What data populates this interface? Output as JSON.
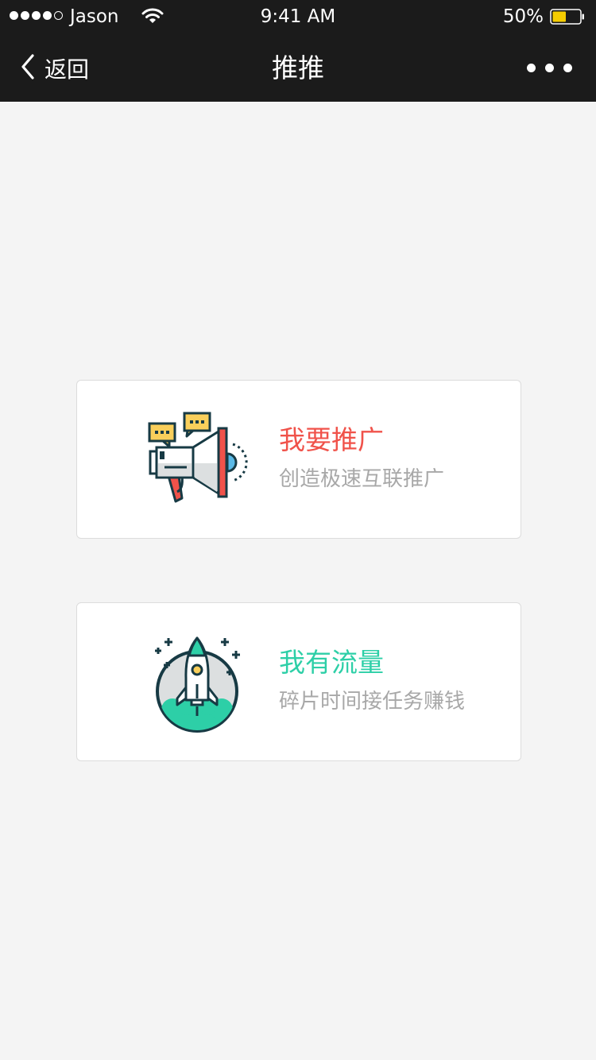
{
  "status_bar": {
    "carrier": "Jason",
    "time": "9:41 AM",
    "battery_percent": "50%",
    "battery_level": 0.5,
    "signal_bars_filled": 4,
    "signal_bars_total": 5
  },
  "nav": {
    "back_label": "返回",
    "title": "推推",
    "more_icon": "more-dots-icon"
  },
  "cards": [
    {
      "icon": "megaphone-icon",
      "title": "我要推广",
      "subtitle": "创造极速互联推广",
      "title_color": "#f0524a"
    },
    {
      "icon": "rocket-icon",
      "title": "我有流量",
      "subtitle": "碎片时间接任务赚钱",
      "title_color": "#2dcfa7"
    }
  ],
  "colors": {
    "bar_background": "#1b1b1b",
    "page_background": "#f4f4f4",
    "battery_fill": "#f5cc00",
    "subtitle": "#a8a8a8"
  }
}
